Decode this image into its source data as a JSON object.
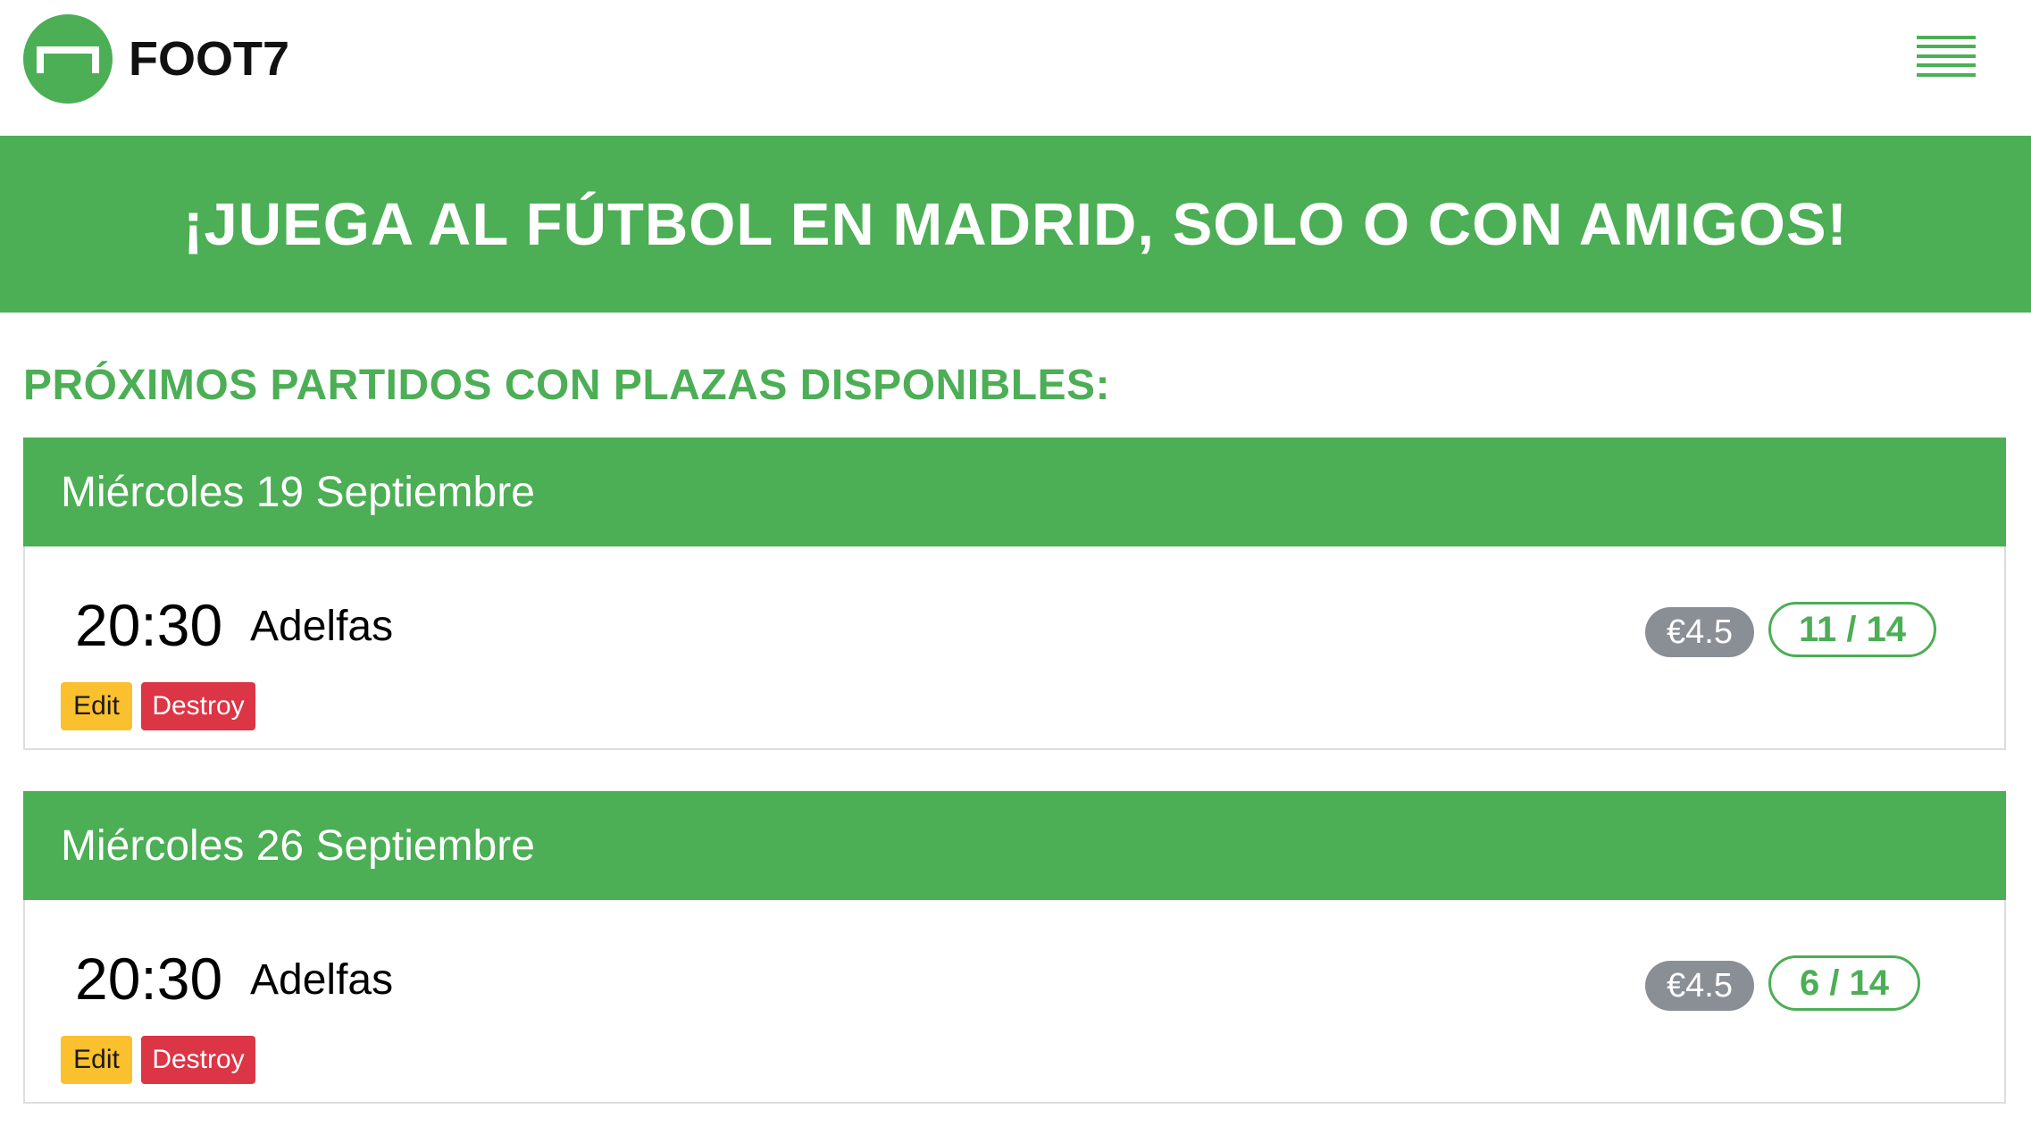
{
  "brand": {
    "name": "FOOT7",
    "logo_icon": "goal-icon",
    "menu_icon": "hamburger-menu-icon",
    "accent_color": "#4cae55"
  },
  "hero": {
    "title": "¡JUEGA AL FÚTBOL EN MADRID, SOLO O CON AMIGOS!"
  },
  "section": {
    "heading": "PRÓXIMOS PARTIDOS CON PLAZAS DISPONIBLES:"
  },
  "matches": [
    {
      "date": "Miércoles 19 Septiembre",
      "time": "20:30",
      "venue": "Adelfas",
      "price": "€4.5",
      "slots": "11 / 14",
      "edit_label": "Edit",
      "destroy_label": "Destroy"
    },
    {
      "date": "Miércoles 26 Septiembre",
      "time": "20:30",
      "venue": "Adelfas",
      "price": "€4.5",
      "slots": "6 / 14",
      "edit_label": "Edit",
      "destroy_label": "Destroy"
    }
  ]
}
